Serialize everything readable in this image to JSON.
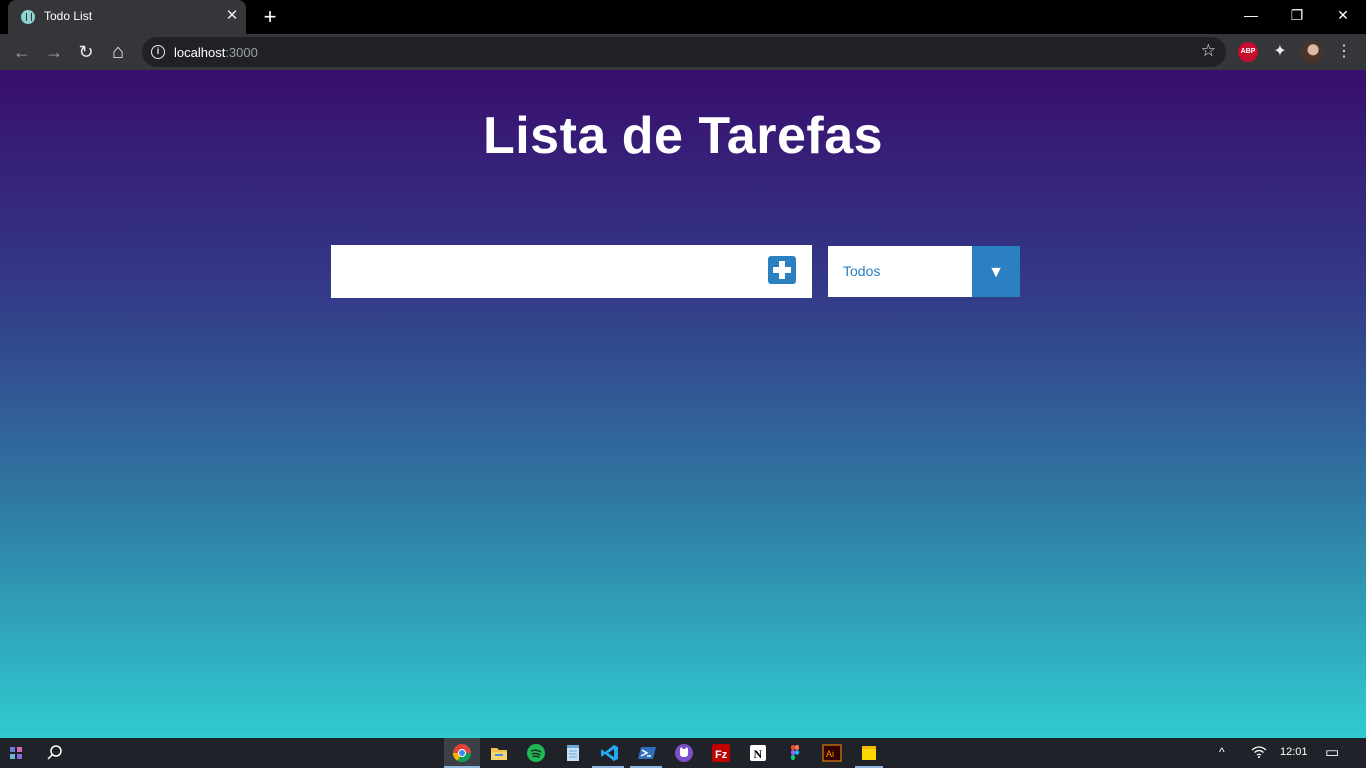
{
  "browser": {
    "tab_title": "Todo List",
    "tab_close": "✕",
    "new_tab": "+",
    "url_host": "localhost",
    "url_port": ":3000",
    "window_controls": {
      "minimize": "—",
      "restore": "❐",
      "close": "✕"
    },
    "nav": {
      "back": "←",
      "forward": "→",
      "reload": "↻",
      "home": "⌂"
    },
    "extensions": {
      "adblock_label": "ABP"
    },
    "icons": [
      "info-icon",
      "star-icon",
      "puzzle-icon",
      "avatar",
      "menu-icon"
    ]
  },
  "page": {
    "heading": "Lista de Tarefas",
    "todo_input": {
      "value": "",
      "placeholder": ""
    },
    "filter": {
      "selected": "Todos",
      "arrow": "▼"
    },
    "colors": {
      "accent": "#2a80c0",
      "gradient_top": "#380e6e",
      "gradient_bottom": "#30cbd0"
    }
  },
  "taskbar": {
    "clock": "12:01",
    "pinned_apps": [
      "windows-start",
      "search",
      "chrome",
      "file-explorer",
      "spotify",
      "notepad",
      "vscode",
      "powershell",
      "github-desktop",
      "filezilla",
      "notion",
      "figma",
      "illustrator",
      "sticky-notes"
    ],
    "tray": {
      "chevron": "^",
      "notifications": "▭"
    }
  }
}
